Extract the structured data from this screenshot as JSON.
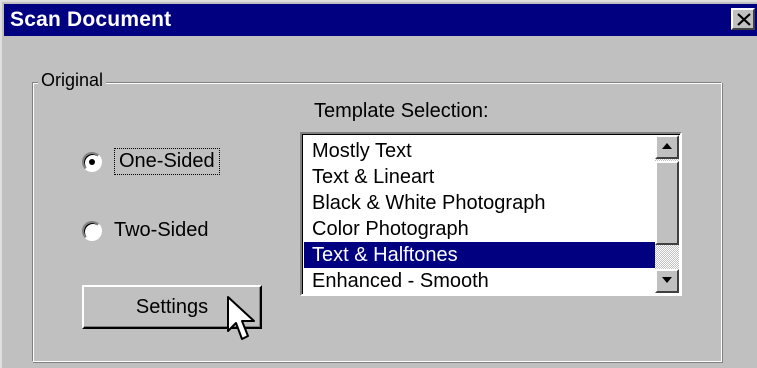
{
  "dialog": {
    "title": "Scan Document",
    "close_glyph": "X"
  },
  "group": {
    "legend": "Original",
    "radios": [
      {
        "label": "One-Sided",
        "checked": true
      },
      {
        "label": "Two-Sided",
        "checked": false
      }
    ],
    "settings_label": "Settings",
    "template_label": "Template Selection:",
    "list_items": [
      "Mostly Text",
      "Text & Lineart",
      "Black & White Photograph",
      "Color Photograph",
      "Text & Halftones",
      "Enhanced - Smooth"
    ],
    "selected_item": "Text & Halftones"
  },
  "icons": {
    "close": "close-icon",
    "scroll_up": "arrow-up-icon",
    "scroll_down": "arrow-down-icon",
    "cursor": "mouse-pointer-icon"
  },
  "colors": {
    "titlebar": "#000080",
    "face": "#c0c0c0",
    "selection": "#000080"
  }
}
